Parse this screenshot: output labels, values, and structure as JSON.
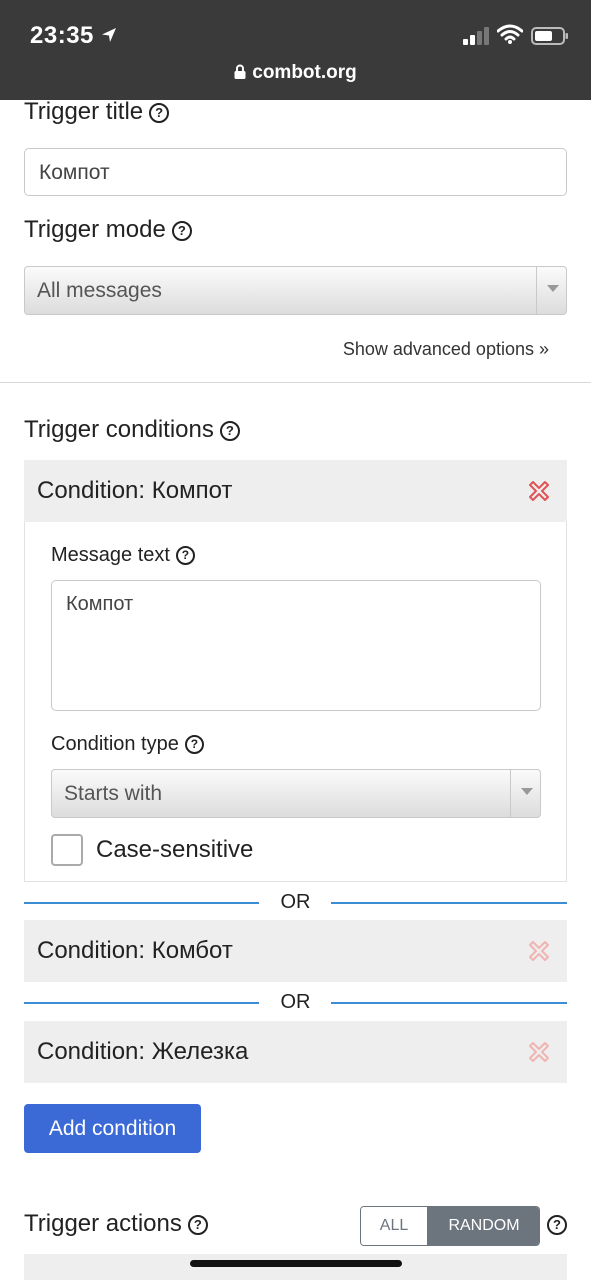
{
  "status_bar": {
    "time": "23:35",
    "url": "combot.org",
    "icons": [
      "location-arrow-icon",
      "signal-icon",
      "wifi-icon",
      "battery-icon",
      "lock-icon"
    ]
  },
  "trigger_title": {
    "label": "Trigger title",
    "value": "Компот"
  },
  "trigger_mode": {
    "label": "Trigger mode",
    "selected": "All messages"
  },
  "advanced_link": "Show advanced options »",
  "trigger_conditions": {
    "label": "Trigger conditions",
    "separator_text": "OR",
    "conditions": [
      {
        "title": "Condition: Компот",
        "message_text_label": "Message text",
        "message_text_value": "Компот",
        "condition_type_label": "Condition type",
        "condition_type_selected": "Starts with",
        "case_sensitive_label": "Case-sensitive",
        "case_sensitive_checked": false
      },
      {
        "title": "Condition: Комбот"
      },
      {
        "title": "Condition: Железка"
      }
    ],
    "add_button": "Add condition"
  },
  "trigger_actions": {
    "label": "Trigger actions",
    "modes": [
      "ALL",
      "RANDOM"
    ],
    "selected_mode": "RANDOM"
  },
  "colors": {
    "primary_button": "#3b6ad6",
    "or_line": "#3c8dd6",
    "delete_icon_active": "#e05555",
    "delete_icon_faded": "#f0b4b4",
    "segment_active": "#6c757d"
  }
}
